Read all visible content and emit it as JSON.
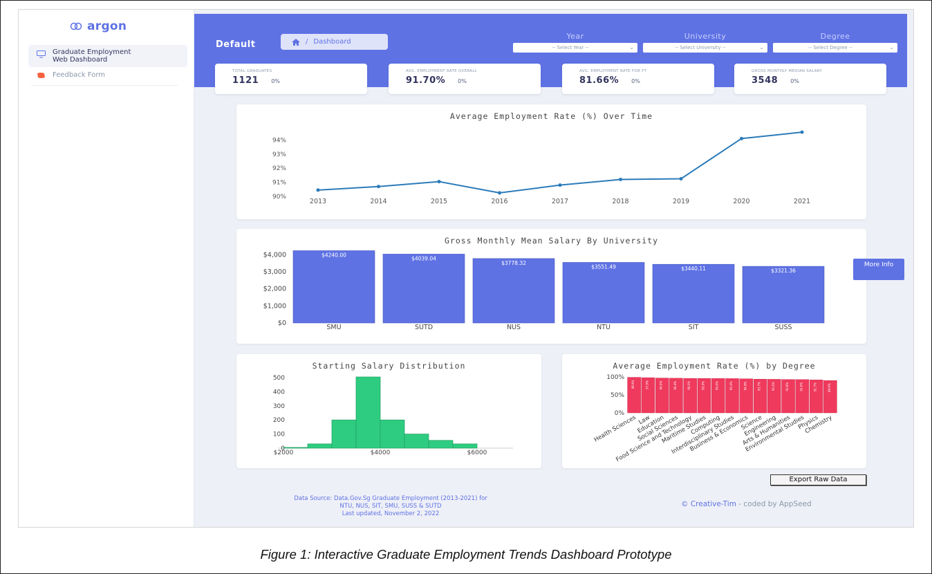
{
  "sidebar": {
    "brand": "argon",
    "items": [
      {
        "label_line1": "Graduate Employment",
        "label_line2": "Web Dashboard",
        "icon": "monitor-icon",
        "active": true
      },
      {
        "label": "Feedback Form",
        "icon": "feedback-icon",
        "active": false
      }
    ]
  },
  "header": {
    "title": "Default",
    "breadcrumb": "Dashboard",
    "filters": [
      {
        "label": "Year",
        "placeholder": "-- Select Year --"
      },
      {
        "label": "University",
        "placeholder": "-- Select University --"
      },
      {
        "label": "Degree",
        "placeholder": "-- Select Degree --"
      }
    ]
  },
  "stats": [
    {
      "label": "TOTAL GRADUATES",
      "value": "1121",
      "change": "0%"
    },
    {
      "label": "AVG. EMPLOYMENT RATE OVERALL",
      "value": "91.70%",
      "change": "0%"
    },
    {
      "label": "AVG. EMPLOYMENT RATE FOR FT",
      "value": "81.66%",
      "change": "0%"
    },
    {
      "label": "GROSS MONTHLY MEDIAN SALARY",
      "value": "3548",
      "change": "0%"
    }
  ],
  "buttons": {
    "more_info": "More Info",
    "export": "Export Raw Data"
  },
  "footer": {
    "source_line1": "Data Source: Data.Gov.Sg Graduate Employment (2013-2021) for",
    "source_line2": "NTU, NUS, SIT, SMU, SUSS & SUTD",
    "source_line3": "Last updated, November 2, 2022",
    "copyright": "© Creative-Tim",
    "coded_by": " - coded by AppSeed"
  },
  "caption": "Figure 1: Interactive Graduate Employment Trends Dashboard Prototype",
  "colors": {
    "primary": "#5e72e4",
    "line": "#2b7bb9",
    "histogram": "#2ecc80",
    "degree_bars": "#ef3a5d"
  },
  "chart_data": [
    {
      "type": "line",
      "title": "Average  Employment Rate (%) Over Time",
      "x": [
        "2013",
        "2014",
        "2015",
        "2016",
        "2017",
        "2018",
        "2019",
        "2020",
        "2021"
      ],
      "values": [
        90.45,
        90.7,
        91.05,
        90.25,
        90.8,
        91.2,
        91.25,
        94.1,
        94.55
      ],
      "yticks": [
        "90%",
        "91%",
        "92%",
        "93%",
        "94%"
      ],
      "ylim": [
        90,
        94.9
      ]
    },
    {
      "type": "bar",
      "title": "Gross Monthly Mean Salary By University",
      "categories": [
        "SMU",
        "SUTD",
        "NUS",
        "NTU",
        "SIT",
        "SUSS"
      ],
      "values": [
        4240.0,
        4039.04,
        3778.32,
        3551.49,
        3440.11,
        3321.36
      ],
      "labels": [
        "$4240.00",
        "$4039.04",
        "$3778.32",
        "$3551.49",
        "$3440.11",
        "$3321.36"
      ],
      "yticks": [
        "$0",
        "$1,000",
        "$2,000",
        "$3,000",
        "$4,000"
      ],
      "ylim": [
        0,
        4300
      ]
    },
    {
      "type": "bar",
      "title": "Starting Salary Distribution",
      "x_edges": [
        2000,
        2500,
        3000,
        3500,
        4000,
        4500,
        5000,
        5500,
        6000
      ],
      "values": [
        5,
        30,
        200,
        505,
        200,
        100,
        55,
        30,
        5
      ],
      "xticks": [
        "$2000",
        "$4000",
        "$6000"
      ],
      "yticks": [
        "0",
        "100",
        "200",
        "300",
        "400",
        "500"
      ],
      "ylim": [
        0,
        520
      ]
    },
    {
      "type": "bar",
      "title": "Average Employment Rate (%) by Degree",
      "categories": [
        "Health Sciences",
        "Law",
        "Education",
        "Social Sciences",
        "Food Science and Technology",
        "Maritime Studies",
        "Computing",
        "Interdisciplinary Studies",
        "Business & Economics",
        "Science",
        "Engineering",
        "Arts & Humanities",
        "Environmental Studies",
        "Physics",
        "Chemistry"
      ],
      "values": [
        98.9,
        97.9,
        96.9,
        96.4,
        96.0,
        95.9,
        95.6,
        95.4,
        94.8,
        93.7,
        93.4,
        92.8,
        92.6,
        91.7,
        89.9
      ],
      "yticks": [
        "0%",
        "50%",
        "100%"
      ],
      "ylim": [
        0,
        100
      ]
    }
  ]
}
